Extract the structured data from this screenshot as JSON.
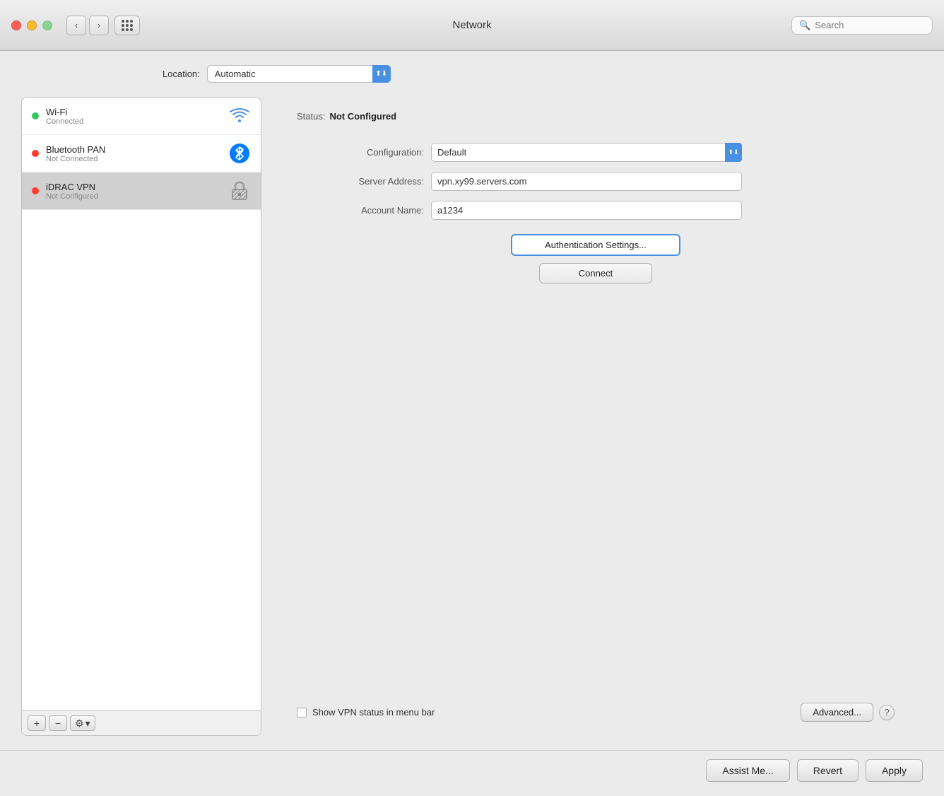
{
  "window": {
    "title": "Network"
  },
  "titlebar": {
    "back_btn": "‹",
    "forward_btn": "›",
    "search_placeholder": "Search"
  },
  "location": {
    "label": "Location:",
    "value": "Automatic"
  },
  "network_list": {
    "items": [
      {
        "id": "wifi",
        "name": "Wi-Fi",
        "status": "Connected",
        "dot": "green",
        "icon_type": "wifi",
        "selected": false
      },
      {
        "id": "bluetooth",
        "name": "Bluetooth PAN",
        "status": "Not Connected",
        "dot": "red",
        "icon_type": "bluetooth",
        "selected": false
      },
      {
        "id": "idrac",
        "name": "iDRAC VPN",
        "status": "Not Configured",
        "dot": "red",
        "icon_type": "vpn",
        "selected": true
      }
    ],
    "toolbar": {
      "add": "+",
      "remove": "−",
      "gear": "⚙",
      "chevron": "▾"
    }
  },
  "detail_panel": {
    "status_label": "Status:",
    "status_value": "Not Configured",
    "configuration_label": "Configuration:",
    "configuration_value": "Default",
    "server_address_label": "Server Address:",
    "server_address_value": "vpn.xy99.servers.com",
    "account_name_label": "Account Name:",
    "account_name_value": "a1234",
    "auth_settings_btn": "Authentication Settings...",
    "connect_btn": "Connect",
    "show_vpn_label": "Show VPN status in menu bar",
    "advanced_btn": "Advanced...",
    "help_btn": "?"
  },
  "footer": {
    "assist_btn": "Assist Me...",
    "revert_btn": "Revert",
    "apply_btn": "Apply"
  }
}
